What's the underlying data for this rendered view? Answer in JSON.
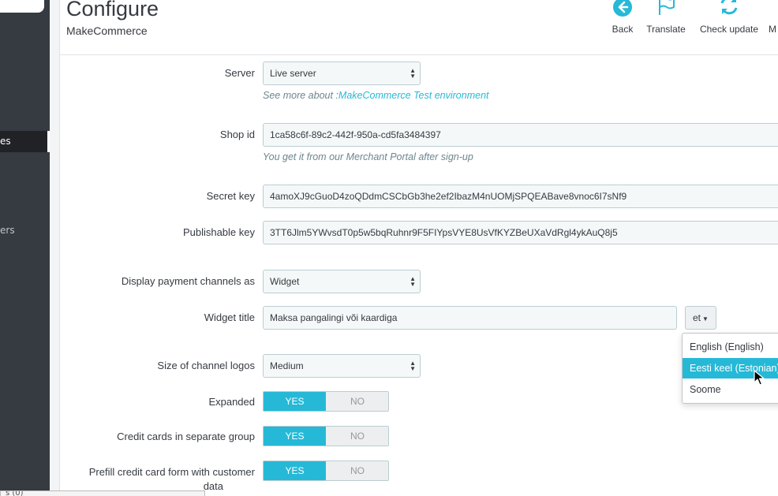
{
  "sidebar": {
    "items": [
      {
        "label": "es",
        "active": true
      },
      {
        "label": "ers",
        "active": false
      }
    ],
    "bottom_bar_text": "s (0)"
  },
  "header": {
    "title": "Configure",
    "subtitle": "MakeCommerce",
    "toolbar": [
      {
        "label": "Back",
        "icon": "back-arrow-icon"
      },
      {
        "label": "Translate",
        "icon": "flag-icon"
      },
      {
        "label": "Check update",
        "icon": "refresh-icon"
      },
      {
        "label": "M",
        "icon": ""
      }
    ]
  },
  "form": {
    "server": {
      "label": "Server",
      "value": "Live server",
      "help_prefix": "See more about :",
      "help_link": "MakeCommerce Test environment"
    },
    "shop_id": {
      "label": "Shop id",
      "value": "1ca58c6f-89c2-442f-950a-cd5fa3484397",
      "help": "You get it from our Merchant Portal after sign-up"
    },
    "secret_key": {
      "label": "Secret key",
      "value": "4amoXJ9cGuoD4zoQDdmCSCbGb3he2ef2IbazM4nUOMjSPQEABave8vnoc6I7sNf9"
    },
    "publishable_key": {
      "label": "Publishable key",
      "value": "3TT6Jlm5YWvsdT0p5w5bqRuhnr9F5FIYpsVYE8UsVfKYZBeUXaVdRgl4ykAuQ8j5"
    },
    "display_channels": {
      "label": "Display payment channels as",
      "value": "Widget"
    },
    "widget_title": {
      "label": "Widget title",
      "value": "Maksa pangalingi või kaardiga",
      "lang_code": "et"
    },
    "language_menu": [
      {
        "label": "English (English)",
        "active": false
      },
      {
        "label": "Eesti keel (Estonian)",
        "active": true
      },
      {
        "label": "Soome",
        "active": false
      }
    ],
    "logo_size": {
      "label": "Size of channel logos",
      "value": "Medium"
    },
    "expanded": {
      "label": "Expanded",
      "yes": "YES",
      "no": "NO"
    },
    "credit_cards_group": {
      "label": "Credit cards in separate group",
      "yes": "YES",
      "no": "NO"
    },
    "prefill": {
      "label_line1": "Prefill credit card form with customer",
      "label_line2": "data",
      "yes": "YES",
      "no": "NO"
    }
  },
  "colors": {
    "accent": "#25b9d7",
    "sidebar": "#363a41",
    "text": "#363a41"
  }
}
